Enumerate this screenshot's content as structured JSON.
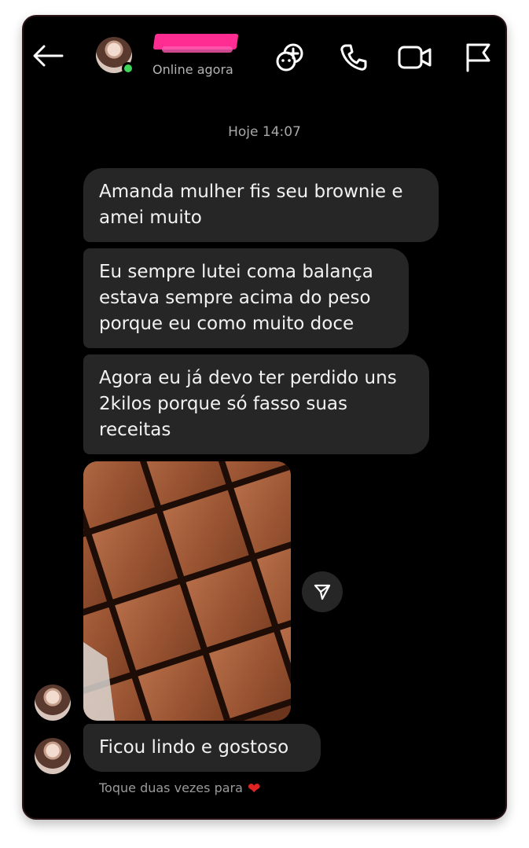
{
  "header": {
    "back_icon": "arrow-left-icon",
    "status": "Online agora",
    "icons": [
      "effects-icon",
      "phone-icon",
      "video-icon",
      "flag-icon"
    ]
  },
  "conversation": {
    "timestamp": "Hoje 14:07",
    "messages": [
      {
        "text": "Amanda mulher fis seu brownie e\namei muito"
      },
      {
        "text": "Eu sempre lutei coma balança\nestava sempre acima do peso\nporque eu como muito doce"
      },
      {
        "text": "Agora eu já devo ter perdido uns\n2kilos porque só fasso suas\nreceitas"
      },
      {
        "text": "Ficou lindo e gostoso"
      }
    ],
    "photo_icon": "brownie-photo",
    "share_icon": "send-icon"
  },
  "footer": {
    "hint": "Toque duas vezes para",
    "heart": "❤"
  },
  "colors": {
    "background": "#000000",
    "bubble": "#262626",
    "text": "#f2f2f2",
    "online": "#3fd45a",
    "redaction": "#ff2d92",
    "heart": "#e02424"
  }
}
